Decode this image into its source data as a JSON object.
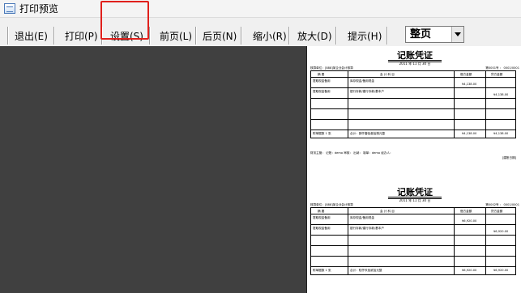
{
  "window": {
    "title": "打印预览"
  },
  "toolbar": {
    "exit": "退出(E)",
    "print": "打印(P)",
    "settings": "设置(S)",
    "prev_page": "前页(L)",
    "next_page": "后页(N)",
    "zoom_out": "缩小(R)",
    "zoom_in": "放大(D)",
    "hint": "提示(H)",
    "view_select": "整页"
  },
  "vouchers": [
    {
      "title": "记账凭证",
      "date": "2011 年 11 月 30 日",
      "company": "核算单位：[888]某企业会计核算",
      "number": "第0001号 ： 0001/0001",
      "headers": {
        "summary": "摘    要",
        "account": "会  计  科  目",
        "debit": "借方金额",
        "credit": "贷方金额"
      },
      "rows": [
        {
          "summary": "提取现金备用",
          "account": "库存现金/备用现金",
          "debit": "¥4,138.00",
          "credit": ""
        },
        {
          "summary": "提取现金备用",
          "account": "银行存款/建行存款/基本户",
          "debit": "",
          "credit": "¥4,138.00"
        }
      ],
      "total": {
        "label": "附单据数  1  张",
        "text": "合计：肆仟壹佰叁拾捌元整",
        "debit": "¥4,138.00",
        "credit": "¥4,138.00"
      },
      "footer": "财务主管：  记账：demo  审核：  出纳：  制单：demo  经办人：",
      "footer_end": "[建账日期]"
    },
    {
      "title": "记账凭证",
      "date": "2011 年 11 月 30 日",
      "company": "核算单位：[888]某企业会计核算",
      "number": "第0002号 ： 0001/0001",
      "headers": {
        "summary": "摘    要",
        "account": "会  计  科  目",
        "debit": "借方金额",
        "credit": "贷方金额"
      },
      "rows": [
        {
          "summary": "提取现金备用",
          "account": "库存现金/备用现金",
          "debit": "¥6,920.00",
          "credit": ""
        },
        {
          "summary": "提取现金备用",
          "account": "银行存款/建行存款/基本户",
          "debit": "",
          "credit": "¥6,920.00"
        }
      ],
      "total": {
        "label": "附单据数  1  张",
        "text": "合计：陆仟玖佰贰拾元整",
        "debit": "¥6,920.00",
        "credit": "¥6,920.00"
      }
    }
  ]
}
